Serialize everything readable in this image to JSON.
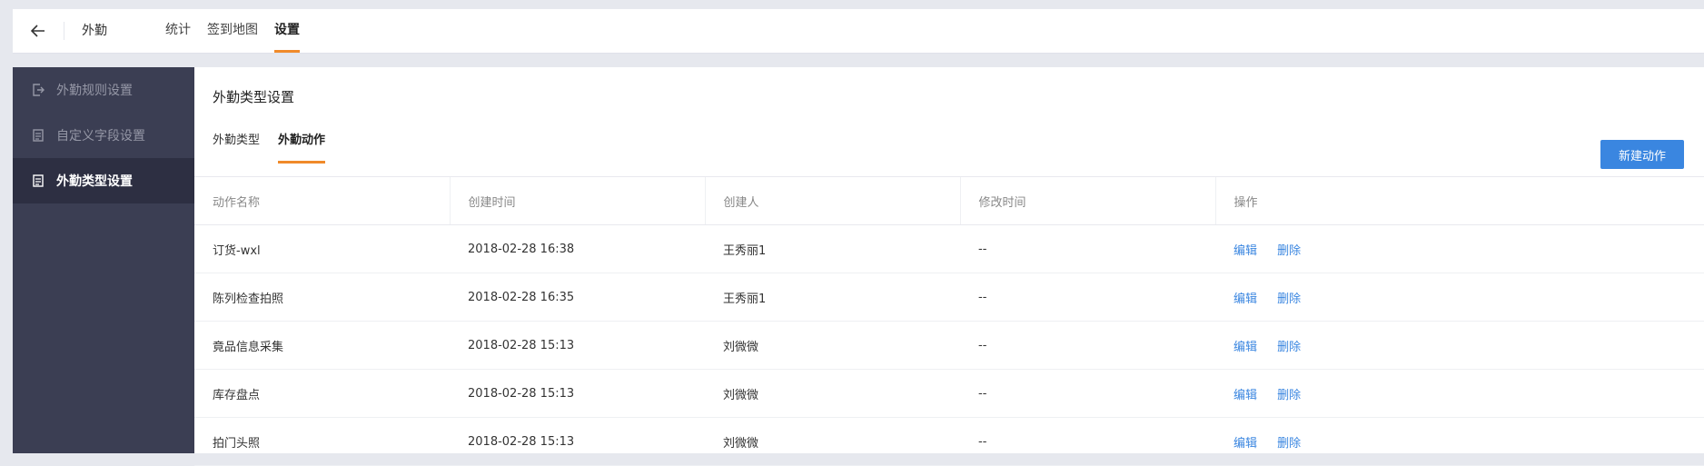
{
  "app": {
    "title": "外勤"
  },
  "nav": {
    "tabs": [
      {
        "label": "统计"
      },
      {
        "label": "签到地图"
      },
      {
        "label": "设置",
        "active": true
      }
    ]
  },
  "sidebar": {
    "items": [
      {
        "label": "外勤规则设置",
        "icon": "exit-icon"
      },
      {
        "label": "自定义字段设置",
        "icon": "document-icon"
      },
      {
        "label": "外勤类型设置",
        "icon": "document-icon",
        "active": true
      }
    ]
  },
  "main": {
    "section_title": "外勤类型设置",
    "subtabs": [
      {
        "label": "外勤类型"
      },
      {
        "label": "外勤动作",
        "active": true
      }
    ],
    "new_button": "新建动作",
    "table": {
      "columns": [
        "动作名称",
        "创建时间",
        "创建人",
        "修改时间",
        "操作"
      ],
      "rows": [
        {
          "name": "订货-wxl",
          "created": "2018-02-28 16:38",
          "creator": "王秀丽1",
          "modified": "--",
          "edit": "编辑",
          "delete": "删除"
        },
        {
          "name": "陈列检查拍照",
          "created": "2018-02-28 16:35",
          "creator": "王秀丽1",
          "modified": "--",
          "edit": "编辑",
          "delete": "删除"
        },
        {
          "name": "竟品信息采集",
          "created": "2018-02-28 15:13",
          "creator": "刘微微",
          "modified": "--",
          "edit": "编辑",
          "delete": "删除"
        },
        {
          "name": "库存盘点",
          "created": "2018-02-28 15:13",
          "creator": "刘微微",
          "modified": "--",
          "edit": "编辑",
          "delete": "删除"
        },
        {
          "name": "拍门头照",
          "created": "2018-02-28 15:13",
          "creator": "刘微微",
          "modified": "--",
          "edit": "编辑",
          "delete": "删除"
        }
      ]
    }
  },
  "colors": {
    "accent_orange": "#f08a2a",
    "primary_blue": "#3a86e0",
    "sidebar_bg": "#3b3e53",
    "sidebar_active_bg": "#2d2f42"
  }
}
